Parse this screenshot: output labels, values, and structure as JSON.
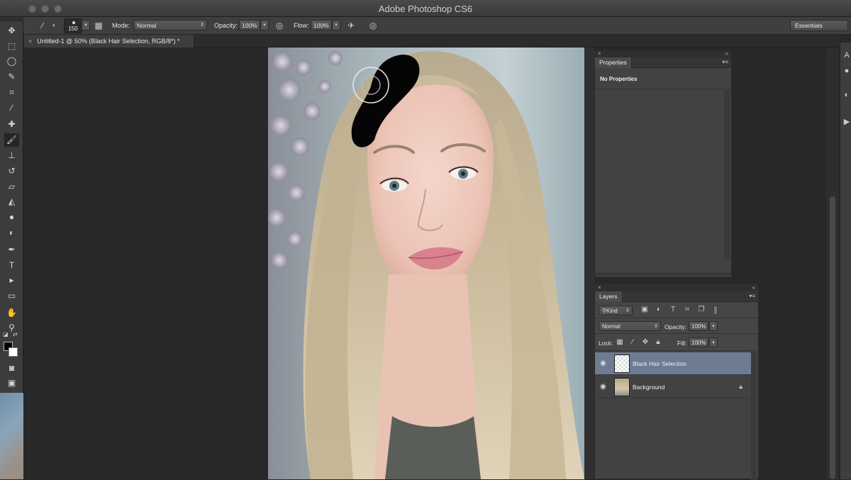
{
  "app": {
    "title": "Adobe Photoshop CS6"
  },
  "options_bar": {
    "brush_size": "150",
    "mode_label": "Mode:",
    "mode_value": "Normal",
    "opacity_label": "Opacity:",
    "opacity_value": "100%",
    "flow_label": "Flow:",
    "flow_value": "100%",
    "workspace": "Essentials"
  },
  "document": {
    "tab_title": "Untitled-1 @ 50% (Black Hair Selection, RGB/8*) *"
  },
  "tools": [
    {
      "icon": "move-icon",
      "glyph": "✥"
    },
    {
      "icon": "marquee-icon",
      "glyph": "⬚"
    },
    {
      "icon": "lasso-icon",
      "glyph": "◯"
    },
    {
      "icon": "quick-selection-icon",
      "glyph": "✎"
    },
    {
      "icon": "crop-icon",
      "glyph": "⌗"
    },
    {
      "icon": "eyedropper-icon",
      "glyph": "⁄"
    },
    {
      "icon": "healing-brush-icon",
      "glyph": "✚"
    },
    {
      "icon": "brush-icon",
      "glyph": "🖌"
    },
    {
      "icon": "clone-stamp-icon",
      "glyph": "⊥"
    },
    {
      "icon": "history-brush-icon",
      "glyph": "↺"
    },
    {
      "icon": "eraser-icon",
      "glyph": "▱"
    },
    {
      "icon": "paint-bucket-icon",
      "glyph": "◭"
    },
    {
      "icon": "blur-icon",
      "glyph": "●"
    },
    {
      "icon": "dodge-icon",
      "glyph": "◐"
    },
    {
      "icon": "pen-icon",
      "glyph": "✒"
    },
    {
      "icon": "type-icon",
      "glyph": "T"
    },
    {
      "icon": "path-selection-icon",
      "glyph": "▸"
    },
    {
      "icon": "rectangle-icon",
      "glyph": "▭"
    },
    {
      "icon": "hand-icon",
      "glyph": "✋"
    },
    {
      "icon": "zoom-icon",
      "glyph": "⚲"
    }
  ],
  "properties_panel": {
    "tab": "Properties",
    "content": "No Properties"
  },
  "layers_panel": {
    "tab": "Layers",
    "filter_kind": "Kind",
    "blend_mode": "Normal",
    "opacity_label": "Opacity:",
    "opacity_value": "100%",
    "lock_label": "Lock:",
    "fill_label": "Fill:",
    "fill_value": "100%",
    "layers": [
      {
        "name": "Black Hair Selection",
        "selected": true,
        "locked": false
      },
      {
        "name": "Background",
        "selected": false,
        "locked": true
      }
    ]
  },
  "colors": {
    "selected_layer": "#6d7b93",
    "foreground": "#000000",
    "background": "#ffffff"
  }
}
